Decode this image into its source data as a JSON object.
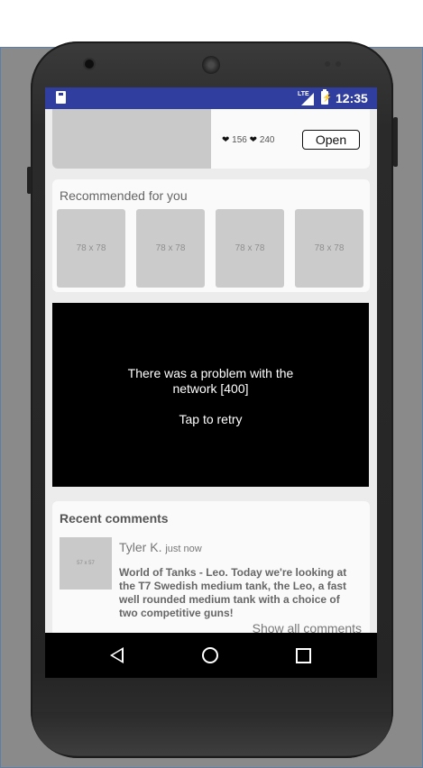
{
  "status_bar": {
    "network": "LTE",
    "time": "12:35"
  },
  "top_card": {
    "likes": "156",
    "comments": "240",
    "open_label": "Open"
  },
  "recommended": {
    "title": "Recommended for you",
    "items": [
      {
        "label": "78 x 78"
      },
      {
        "label": "78 x 78"
      },
      {
        "label": "78 x 78"
      },
      {
        "label": "78 x 78"
      }
    ]
  },
  "error": {
    "line1": "There was a problem with the",
    "line2": "network [400]",
    "retry": "Tap to retry"
  },
  "comments": {
    "title": "Recent comments",
    "items": [
      {
        "avatar_label": "57 x 57",
        "author": "Tyler K.",
        "time": "just now",
        "text": "World of Tanks - Leo. Today we're looking at the T7 Swedish medium tank, the Leo, a fast well rounded medium tank with a choice of two competitive guns!"
      }
    ],
    "show_all": "Show all comments"
  },
  "icons": {
    "sd": "sd-card-icon",
    "signal": "signal-icon",
    "battery": "battery-charging-icon",
    "back": "back-icon",
    "home": "home-icon",
    "recents": "recents-icon"
  },
  "colors": {
    "status_bar": "#303f9f",
    "error_bg": "#000000",
    "card_bg": "#fafafa"
  }
}
